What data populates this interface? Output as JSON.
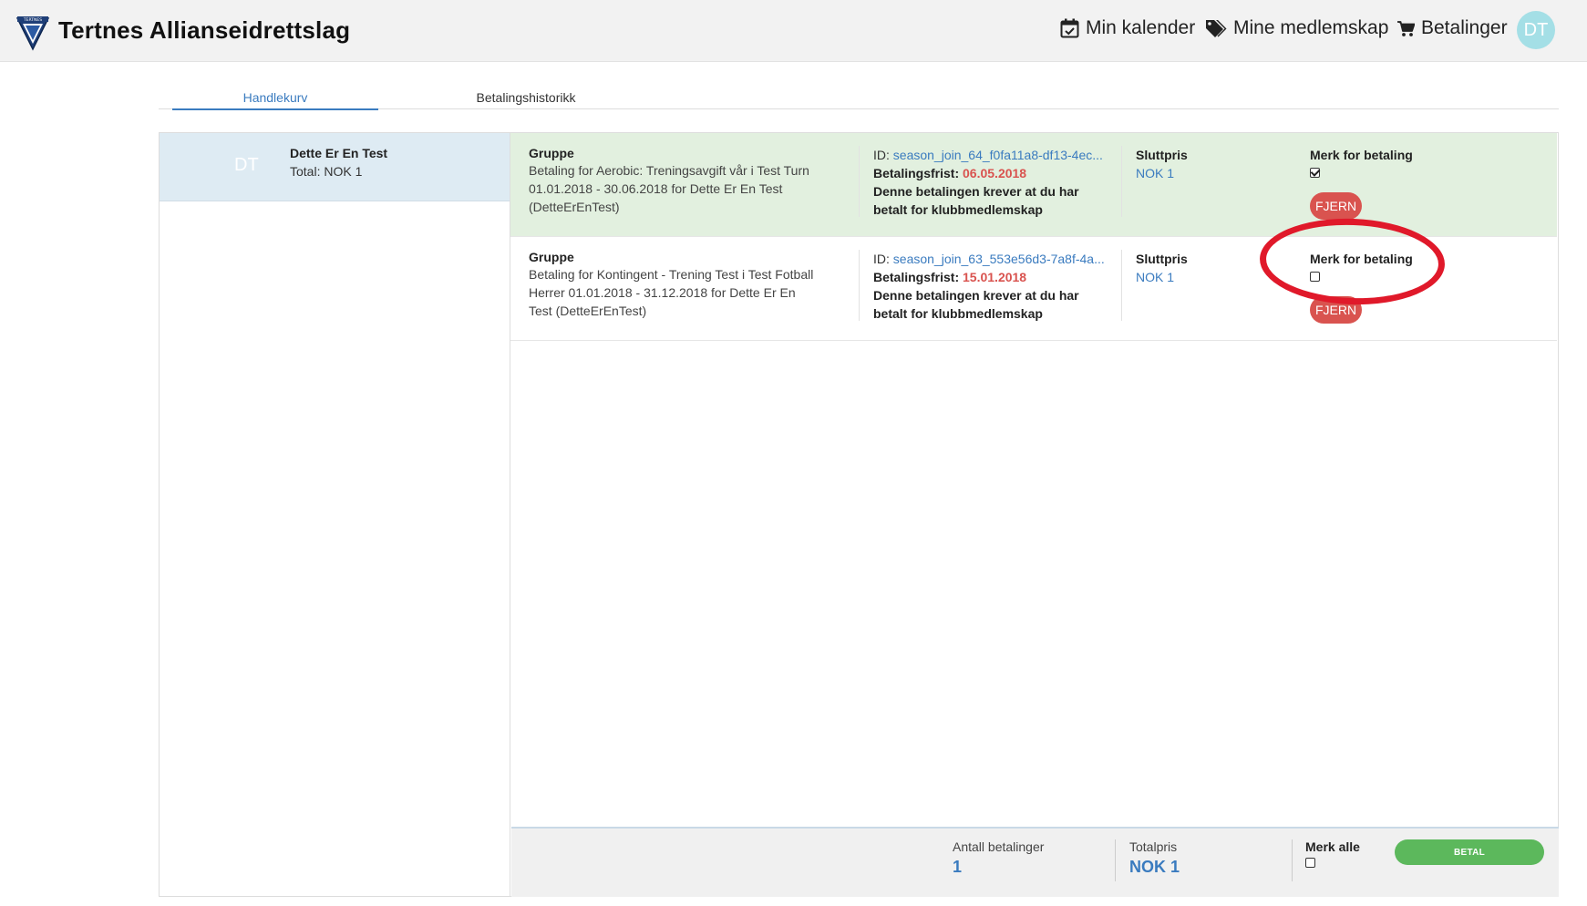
{
  "header": {
    "brand": "Tertnes Allianseidrettslag",
    "logo_text": "TERTNES",
    "nav": [
      {
        "label": "Min kalender",
        "icon": "calendar-check-icon"
      },
      {
        "label": "Mine medlemskap",
        "icon": "tags-icon"
      },
      {
        "label": "Betalinger",
        "icon": "cart-icon"
      }
    ],
    "avatar_initials": "DT"
  },
  "tabs": [
    {
      "label": "Handlekurv",
      "active": true
    },
    {
      "label": "Betalingshistorikk",
      "active": false
    }
  ],
  "member": {
    "initials": "DT",
    "name": "Dette Er En Test",
    "total": "Total: NOK 1"
  },
  "payments": [
    {
      "group_label": "Gruppe",
      "description": "Betaling for Aerobic: Treningsavgift vår i Test Turn 01.01.2018 - 30.06.2018 for Dette Er En Test (DetteErEnTest)",
      "id_prefix": "ID: ",
      "id": "season_join_64_f0fa11a8-df13-4ec...",
      "deadline_label": "Betalingsfrist: ",
      "deadline": "06.05.2018",
      "note": "Denne betalingen krever at du har betalt for klubbmedlemskap",
      "price_label": "Sluttpris",
      "price": "NOK 1",
      "mark_label": "Merk for betaling",
      "checked": true,
      "remove_label": "FJERN"
    },
    {
      "group_label": "Gruppe",
      "description": "Betaling for Kontingent - Trening Test i Test Fotball Herrer 01.01.2018 - 31.12.2018 for Dette Er En Test (DetteErEnTest)",
      "id_prefix": "ID: ",
      "id": "season_join_63_553e56d3-7a8f-4a...",
      "deadline_label": "Betalingsfrist: ",
      "deadline": "15.01.2018",
      "note": "Denne betalingen krever at du har betalt for klubbmedlemskap",
      "price_label": "Sluttpris",
      "price": "NOK 1",
      "mark_label": "Merk for betaling",
      "checked": false,
      "remove_label": "FJERN"
    }
  ],
  "footer": {
    "count_label": "Antall betalinger",
    "count_value": "1",
    "total_label": "Totalpris",
    "total_value": "NOK 1",
    "mark_all_label": "Merk alle",
    "pay_label": "BETAL"
  },
  "colors": {
    "accent_blue": "#3a7bbf",
    "danger_red": "#d9534f",
    "success_green": "#5cb85c",
    "selected_row": "#e2f0df",
    "annotation_red": "#e0192a"
  }
}
